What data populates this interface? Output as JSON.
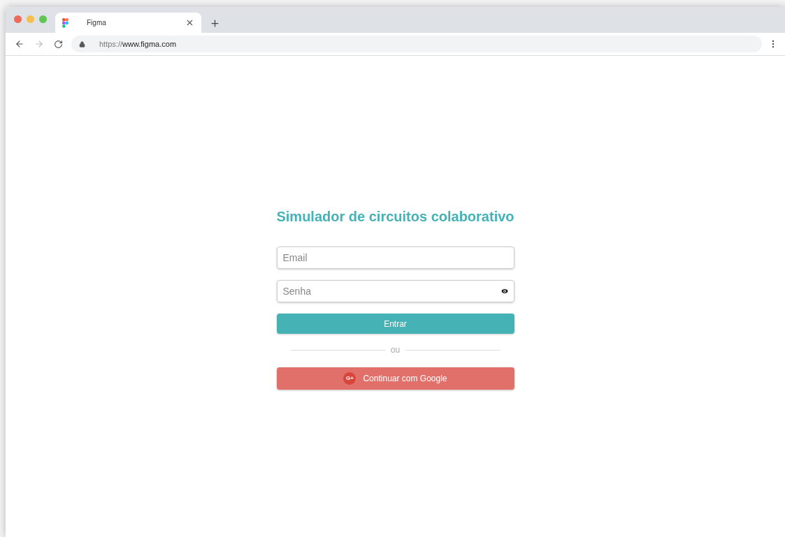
{
  "browser": {
    "tab": {
      "title": "Figma"
    },
    "url": {
      "scheme": "https://",
      "host": "www.figma.com"
    }
  },
  "login": {
    "title": "Simulador de circuitos colaborativo",
    "email": {
      "placeholder": "Email"
    },
    "password": {
      "placeholder": "Senha"
    },
    "submit": "Entrar",
    "separator": "ou",
    "google": {
      "icon_text": "G+",
      "label": "Continuar com Google"
    }
  }
}
